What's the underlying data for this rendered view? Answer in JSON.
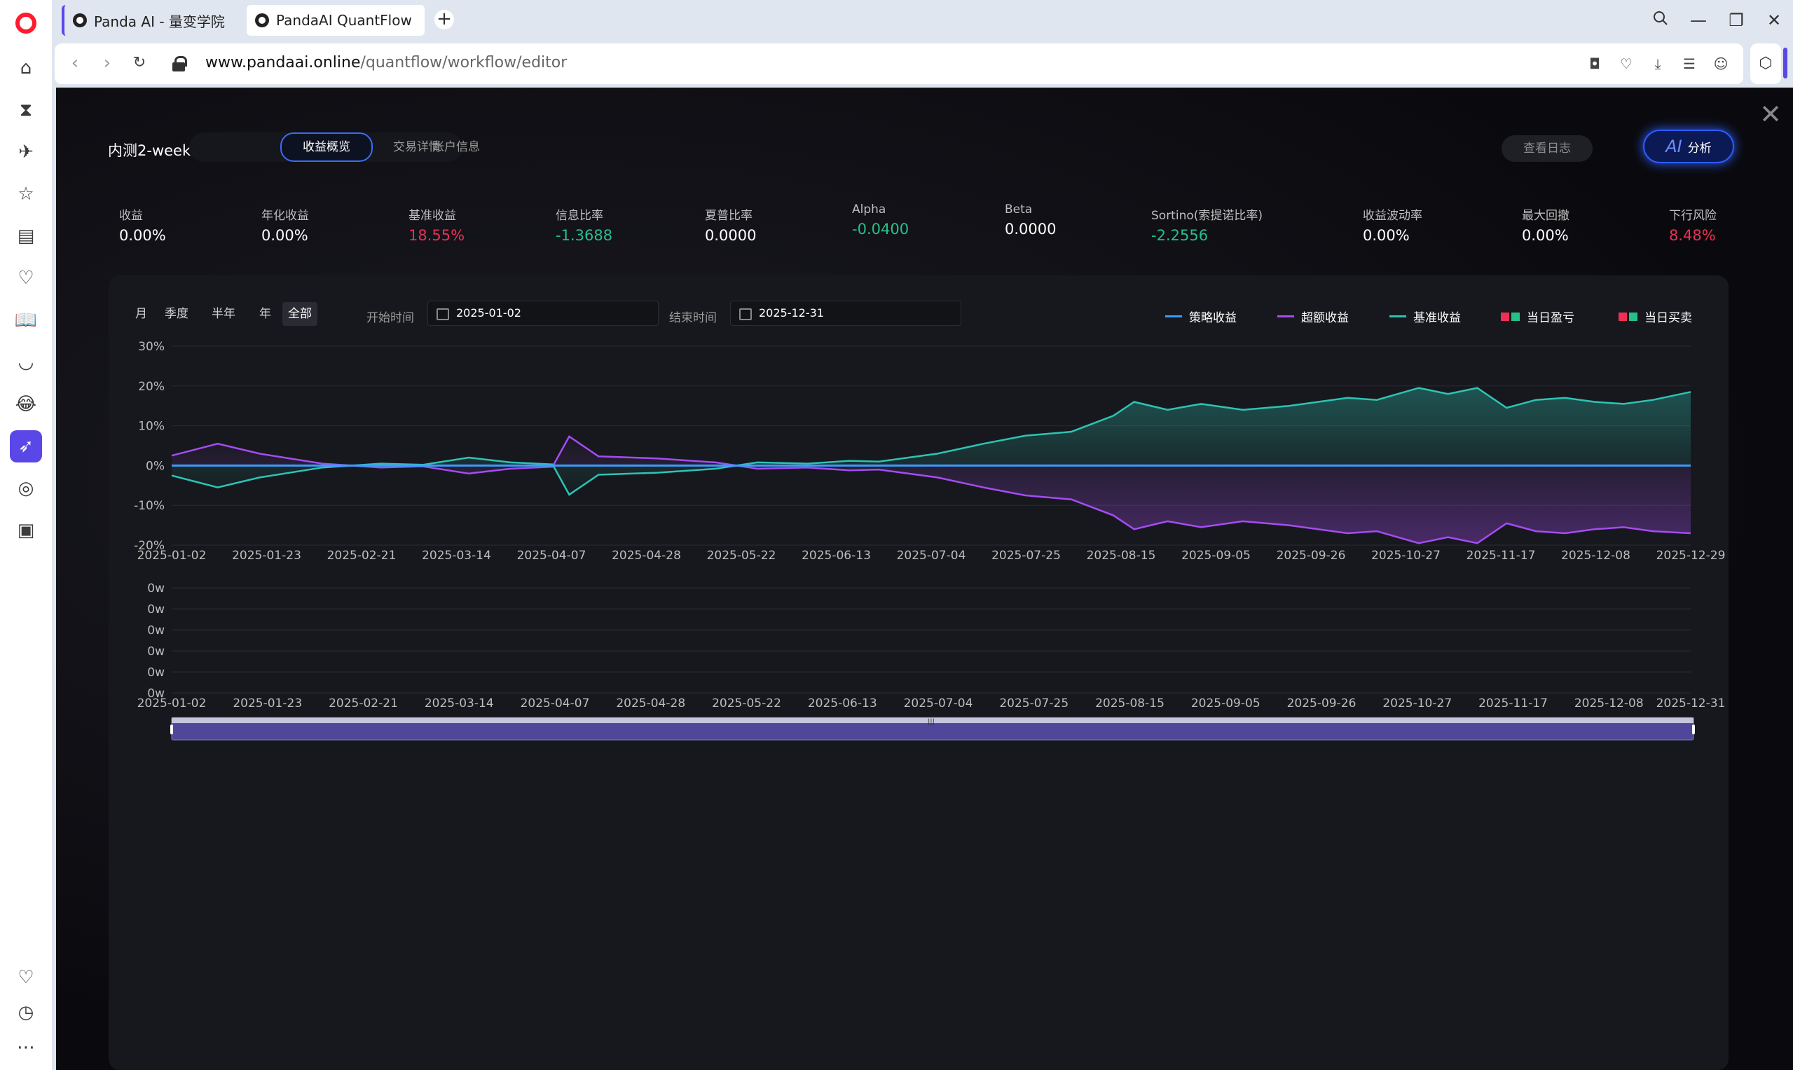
{
  "browser": {
    "tabs": [
      {
        "label": "Panda AI - 量变学院"
      },
      {
        "label": "PandaAI QuantFlow"
      }
    ],
    "url_domain": "www.pandaai.online",
    "url_path": "/quantflow/workflow/editor"
  },
  "report": {
    "title": "内测2-week1",
    "tabs": [
      "收益概览",
      "交易详情",
      "账户信息"
    ],
    "log_button": "查看日志",
    "ai_button_prefix": "AI",
    "ai_button_label": "分析",
    "metrics": [
      {
        "label": "收益",
        "value": "0.00%",
        "tone": "white"
      },
      {
        "label": "年化收益",
        "value": "0.00%",
        "tone": "white"
      },
      {
        "label": "基准收益",
        "value": "18.55%",
        "tone": "red"
      },
      {
        "label": "信息比率",
        "value": "-1.3688",
        "tone": "green"
      },
      {
        "label": "夏普比率",
        "value": "0.0000",
        "tone": "white"
      },
      {
        "label": "Alpha",
        "value": "-0.0400",
        "tone": "green"
      },
      {
        "label": "Beta",
        "value": "0.0000",
        "tone": "white"
      },
      {
        "label": "Sortino(索提诺比率)",
        "value": "-2.2556",
        "tone": "green"
      },
      {
        "label": "收益波动率",
        "value": "0.00%",
        "tone": "white"
      },
      {
        "label": "最大回撤",
        "value": "0.00%",
        "tone": "white"
      },
      {
        "label": "下行风险",
        "value": "8.48%",
        "tone": "red"
      }
    ],
    "periods": [
      "月",
      "季度",
      "半年",
      "年",
      "全部"
    ],
    "active_period": "全部",
    "start_label": "开始时间",
    "start_date": "2025-01-02",
    "end_label": "结束时间",
    "end_date": "2025-12-31"
  },
  "colors": {
    "strategy": "#3a9cff",
    "excess": "#a54cf2",
    "benchmark": "#2cc4b4",
    "up": "#ef2f55",
    "down": "#27c08a"
  },
  "chart_data": [
    {
      "type": "line",
      "legend": [
        "策略收益",
        "超额收益",
        "基准收益",
        "当日盈亏",
        "当日买卖"
      ],
      "ylim": [
        -20,
        30
      ],
      "yticks": [
        "30%",
        "20%",
        "10%",
        "0%",
        "-10%",
        "-20%"
      ],
      "xticks": [
        "2025-01-02",
        "2025-01-23",
        "2025-02-21",
        "2025-03-14",
        "2025-04-07",
        "2025-04-28",
        "2025-05-22",
        "2025-06-13",
        "2025-07-04",
        "2025-07-25",
        "2025-08-15",
        "2025-09-05",
        "2025-09-26",
        "2025-10-27",
        "2025-11-17",
        "2025-12-08",
        "2025-12-29"
      ],
      "series": [
        {
          "name": "策略收益",
          "key": "strategy",
          "x": [
            "2025-01-02",
            "2025-12-31"
          ],
          "values": [
            0,
            0
          ]
        },
        {
          "name": "基准收益",
          "key": "benchmark",
          "x": [
            "2025-01-02",
            "2025-01-13",
            "2025-01-23",
            "2025-02-07",
            "2025-02-21",
            "2025-03-03",
            "2025-03-14",
            "2025-03-24",
            "2025-04-03",
            "2025-04-07",
            "2025-04-14",
            "2025-04-28",
            "2025-05-12",
            "2025-05-22",
            "2025-06-03",
            "2025-06-13",
            "2025-06-20",
            "2025-07-04",
            "2025-07-15",
            "2025-07-25",
            "2025-08-05",
            "2025-08-15",
            "2025-08-20",
            "2025-08-28",
            "2025-09-05",
            "2025-09-15",
            "2025-09-26",
            "2025-10-10",
            "2025-10-17",
            "2025-10-27",
            "2025-11-03",
            "2025-11-10",
            "2025-11-17",
            "2025-11-24",
            "2025-12-01",
            "2025-12-08",
            "2025-12-15",
            "2025-12-22",
            "2025-12-31"
          ],
          "values": [
            -2.5,
            -5.5,
            -3,
            -0.5,
            0.5,
            0.2,
            2,
            0.8,
            0.3,
            -7.3,
            -2.3,
            -1.8,
            -0.8,
            0.8,
            0.5,
            1.2,
            1,
            3,
            5.5,
            7.5,
            8.5,
            12.5,
            16,
            14,
            15.5,
            14,
            15,
            17,
            16.5,
            19.5,
            18,
            19.5,
            14.5,
            16.5,
            17,
            16,
            15.5,
            16.5,
            18.5
          ]
        },
        {
          "name": "超额收益",
          "key": "excess",
          "x": [
            "2025-01-02",
            "2025-01-13",
            "2025-01-23",
            "2025-02-07",
            "2025-02-21",
            "2025-03-03",
            "2025-03-14",
            "2025-03-24",
            "2025-04-03",
            "2025-04-07",
            "2025-04-14",
            "2025-04-28",
            "2025-05-12",
            "2025-05-22",
            "2025-06-03",
            "2025-06-13",
            "2025-06-20",
            "2025-07-04",
            "2025-07-15",
            "2025-07-25",
            "2025-08-05",
            "2025-08-15",
            "2025-08-20",
            "2025-08-28",
            "2025-09-05",
            "2025-09-15",
            "2025-09-26",
            "2025-10-10",
            "2025-10-17",
            "2025-10-27",
            "2025-11-03",
            "2025-11-10",
            "2025-11-17",
            "2025-11-24",
            "2025-12-01",
            "2025-12-08",
            "2025-12-15",
            "2025-12-22",
            "2025-12-31"
          ],
          "values": [
            2.5,
            5.5,
            3,
            0.5,
            -0.5,
            -0.2,
            -2,
            -0.8,
            -0.3,
            7.3,
            2.3,
            1.8,
            0.8,
            -0.8,
            -0.5,
            -1.2,
            -1,
            -3,
            -5.5,
            -7.5,
            -8.5,
            -12.5,
            -16,
            -14,
            -15.5,
            -14,
            -15,
            -17,
            -16.5,
            -19.5,
            -18,
            -19.5,
            -14.5,
            -16.5,
            -17,
            -16,
            -15.5,
            -16.5,
            -17
          ]
        }
      ]
    },
    {
      "type": "bar",
      "yticks": [
        "0w",
        "0w",
        "0w",
        "0w",
        "0w",
        "0w"
      ],
      "xticks": [
        "2025-01-02",
        "2025-01-23",
        "2025-02-21",
        "2025-03-14",
        "2025-04-07",
        "2025-04-28",
        "2025-05-22",
        "2025-06-13",
        "2025-07-04",
        "2025-07-25",
        "2025-08-15",
        "2025-09-05",
        "2025-09-26",
        "2025-10-27",
        "2025-11-17",
        "2025-12-08",
        "2025-12-31"
      ],
      "values": []
    }
  ]
}
